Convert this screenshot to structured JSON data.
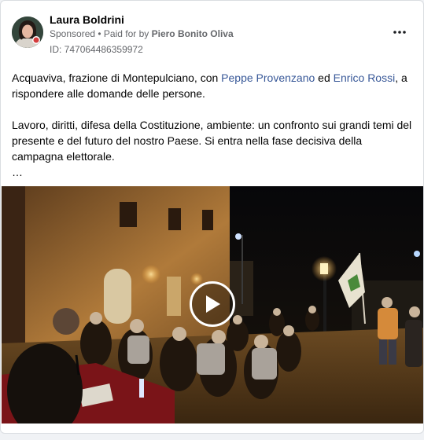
{
  "post": {
    "author": "Laura Boldrini",
    "sponsored": "Sponsored",
    "separator": " • ",
    "paid_for_prefix": "Paid for by ",
    "paid_for_name": "Piero Bonito Oliva",
    "ad_id": "ID: 747064486359972",
    "more_icon": "more-horizontal-icon",
    "text": {
      "p1_a": "Acquaviva, frazione di Montepulciano, con ",
      "p1_link1": "Peppe Provenzano",
      "p1_b": " ed ",
      "p1_link2": "Enrico Rossi",
      "p1_c": ", a rispondere alle domande delle persone.",
      "p2": "Lavoro, diritti, difesa della Costituzione, ambiente: un confronto sui grandi temi del presente e del futuro del nostro Paese. Si entra nella fase decisiva della campagna elettorale.",
      "ellipsis": "…"
    },
    "video": {
      "play_icon": "play-icon"
    }
  },
  "colors": {
    "link": "#385898",
    "secondary_text": "#65676b",
    "background": "#f0f2f5"
  }
}
